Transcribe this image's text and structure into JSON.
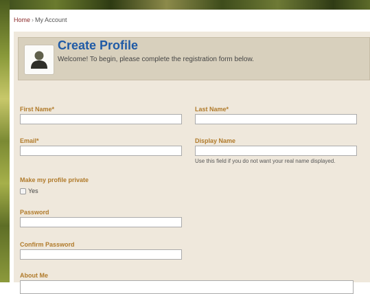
{
  "breadcrumb": {
    "home": "Home",
    "separator": "›",
    "current": "My Account"
  },
  "header": {
    "title": "Create Profile",
    "subtitle": "Welcome! To begin, please complete the registration form below."
  },
  "fields": {
    "first_name": {
      "label": "First Name",
      "required": "*",
      "value": ""
    },
    "last_name": {
      "label": "Last Name",
      "required": "*",
      "value": ""
    },
    "email": {
      "label": "Email",
      "required": "*",
      "value": ""
    },
    "display_name": {
      "label": "Display Name",
      "value": "",
      "hint": "Use this field if you do not want your real name displayed."
    },
    "private": {
      "label": "Make my profile private",
      "option": "Yes"
    },
    "password": {
      "label": "Password",
      "value": ""
    },
    "confirm_password": {
      "label": "Confirm Password",
      "value": ""
    },
    "about_me": {
      "label": "About Me",
      "value": ""
    }
  },
  "colors": {
    "accent_label": "#b07a2a",
    "title_blue": "#1f5aa6",
    "panel_bg": "#efe8dc",
    "header_bg": "#d8d0bd"
  }
}
